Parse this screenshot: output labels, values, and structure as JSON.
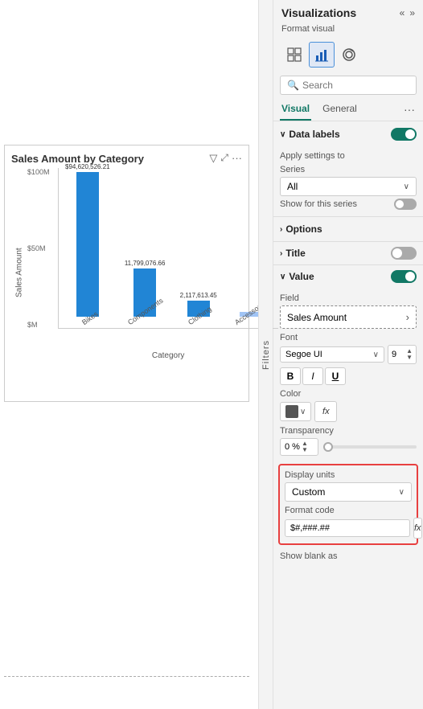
{
  "left_panel": {
    "chart_title": "Sales Amount by Category",
    "y_axis_label": "Sales Amount",
    "x_axis_label": "Category",
    "bars": [
      {
        "label": "Bikes",
        "value_label": "$94,620,526.21",
        "height_pct": 0.95,
        "color": "#2185d5"
      },
      {
        "label": "Components",
        "value_label": "11,799,076.66",
        "height_pct": 0.36,
        "color": "#2185d5"
      },
      {
        "label": "Clothing",
        "value_label": "2,117,613.45",
        "height_pct": 0.1,
        "color": "#2185d5"
      },
      {
        "label": "Accessories",
        "value_label": "",
        "height_pct": 0.03,
        "color": "#2185d5"
      }
    ],
    "y_axis_values": [
      "$100M",
      "$50M",
      "$M"
    ]
  },
  "right_panel": {
    "title": "Visualizations",
    "chevron_left": "«",
    "chevron_right": "»",
    "format_visual_label": "Format visual",
    "viz_icons": [
      "grid",
      "bar-chart",
      "donut"
    ],
    "search_placeholder": "Search",
    "tabs": [
      {
        "label": "Visual",
        "active": true
      },
      {
        "label": "General",
        "active": false
      }
    ],
    "tabs_more": "···",
    "data_labels_section": {
      "label": "Data labels",
      "toggle_state": "On"
    },
    "apply_settings": {
      "label": "Apply settings to",
      "series_label": "Series",
      "series_value": "All",
      "show_for_series_label": "Show for this series",
      "show_for_series_toggle": "off"
    },
    "options_section": {
      "label": "Options"
    },
    "title_section": {
      "label": "Title",
      "toggle_state": "Off"
    },
    "value_section": {
      "label": "Value",
      "toggle_state": "On",
      "field_label": "Field",
      "field_value": "Sales Amount",
      "font_label": "Font",
      "font_family": "Segoe UI",
      "font_size": "9",
      "bold_label": "B",
      "italic_label": "I",
      "underline_label": "U",
      "color_label": "Color",
      "color_value": "#555555",
      "fx_label": "fx",
      "transparency_label": "Transparency",
      "transparency_value": "0 %"
    },
    "display_units_section": {
      "label": "Display units",
      "value": "Custom",
      "highlighted": true
    },
    "format_code_section": {
      "label": "Format code",
      "value": "$#,###.##",
      "fx_label": "fx"
    },
    "show_blank_as_label": "Show blank as"
  }
}
